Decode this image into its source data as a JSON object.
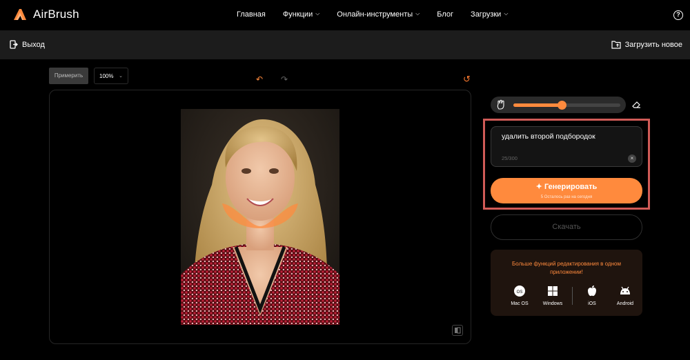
{
  "nav": {
    "brand": "AirBrush",
    "items": [
      {
        "label": "Главная",
        "dropdown": false
      },
      {
        "label": "Функции",
        "dropdown": true
      },
      {
        "label": "Онлайн-инструменты",
        "dropdown": true
      },
      {
        "label": "Блог",
        "dropdown": false
      },
      {
        "label": "Загрузки",
        "dropdown": true
      }
    ],
    "help_icon": "question-circle-icon"
  },
  "subbar": {
    "exit_label": "Выход",
    "upload_new_label": "Загрузить новое"
  },
  "canvas_controls": {
    "try_label": "Примерить",
    "zoom_value": "100%"
  },
  "panel": {
    "brush_size_fraction": 0.45,
    "prompt": {
      "value": "удалить второй подбородок",
      "counter": "25/300"
    },
    "generate": {
      "label": "Генерировать",
      "sub": "5 Осталось раз на сегодня"
    },
    "download_label": "Скачать",
    "promo": {
      "title": "Больше функций редактирования в одном приложении!",
      "platforms": [
        {
          "label": "Mac OS",
          "icon": "macos-icon"
        },
        {
          "label": "Windows",
          "icon": "windows-icon"
        },
        {
          "label": "iOS",
          "icon": "apple-icon"
        },
        {
          "label": "Android",
          "icon": "android-icon"
        }
      ]
    }
  },
  "colors": {
    "accent": "#ff8a3d",
    "highlight": "#d05b57",
    "background": "#000000"
  }
}
